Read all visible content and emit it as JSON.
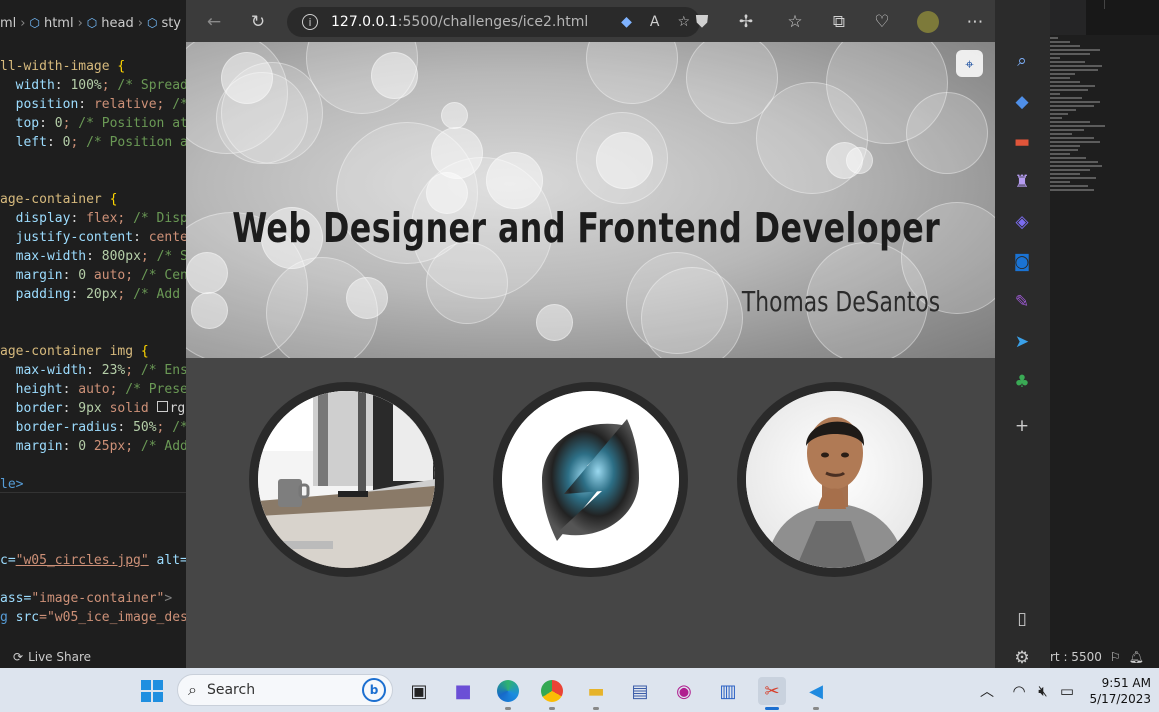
{
  "vscode": {
    "breadcrumb": [
      "ml",
      "html",
      "head",
      "sty"
    ],
    "code_lines": [
      {
        "sel": "ll-width-image {"
      },
      {
        "prop": "width",
        "val": "100%;",
        "com": "/* Spread"
      },
      {
        "prop": "position",
        "val": "relative;",
        "com": "/*"
      },
      {
        "prop": "top",
        "val": "0;",
        "com": "/* Position at"
      },
      {
        "prop": "left",
        "val": "0;",
        "com": "/* Position at"
      },
      {},
      {},
      {
        "sel": "age-container {"
      },
      {
        "prop": "display",
        "val": "flex;",
        "com": "/* Displ"
      },
      {
        "prop": "justify-content",
        "val": "center"
      },
      {
        "prop": "max-width",
        "val": "800px;",
        "com": "/* Se"
      },
      {
        "prop": "margin",
        "val": "0 auto;",
        "com": "/* Cent"
      },
      {
        "prop": "padding",
        "val": "20px;",
        "com": "/* Add s"
      },
      {},
      {},
      {
        "sel": "age-container img {"
      },
      {
        "prop": "max-width",
        "val": "23%;",
        "com": "/* Ensu"
      },
      {
        "prop": "height",
        "val": "auto;",
        "com": "/* Preser"
      },
      {
        "prop": "border",
        "val": "9px solid",
        "swatch": true,
        "extra": "rgb"
      },
      {
        "prop": "border-radius",
        "val": "50%;",
        "com": "/*"
      },
      {
        "prop": "margin",
        "val": "0 25px;",
        "com": "/* Add"
      }
    ],
    "close_style": "le>",
    "html_line_1": {
      "pre": "c=",
      "str": "\"w05_circles.jpg\"",
      "post": " alt="
    },
    "html_line_2": {
      "pre": "ass=",
      "str": "\"image-container\"",
      "post": ">"
    },
    "html_line_3": {
      "pre": "g ",
      "attr": "src",
      "str": "=\"w05_ice_image_des"
    },
    "status_left": "Live Share",
    "status_right_port": "rt : 5500"
  },
  "browser": {
    "url_host": "127.0.0.1",
    "url_path": ":5500/challenges/ice2.html",
    "hero_title": "Web Designer and Frontend Developer",
    "hero_subtitle": "Thomas DeSantos"
  },
  "taskbar": {
    "search_placeholder": "Search",
    "time": "9:51 AM",
    "date": "5/17/2023"
  },
  "colors": {
    "browser_bg": "#3b3b3b",
    "page_bg": "#464646",
    "circle_border": "#2a2a2a",
    "taskbar_bg": "#dde4ee"
  }
}
